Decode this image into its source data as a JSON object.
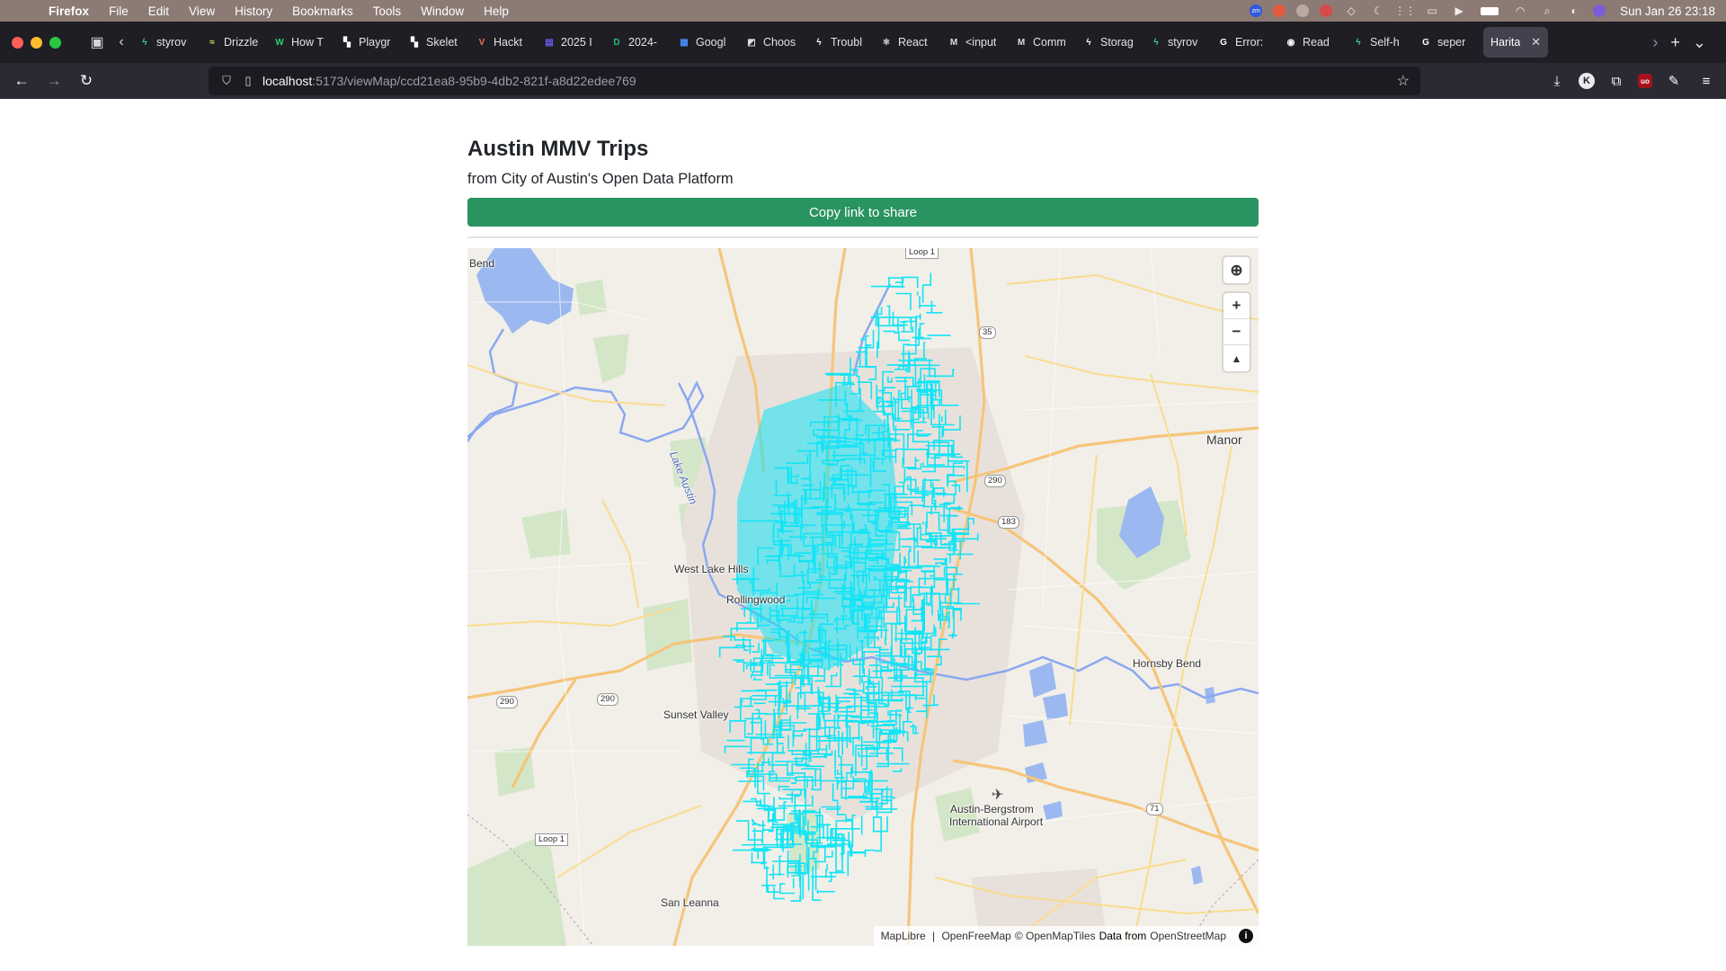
{
  "menubar": {
    "app_name": "Firefox",
    "items": [
      "File",
      "Edit",
      "View",
      "History",
      "Bookmarks",
      "Tools",
      "Window",
      "Help"
    ],
    "status_zm": "zm",
    "clock": "Sun Jan 26  23:18"
  },
  "browser": {
    "tabs": [
      {
        "label": "styrov",
        "icon": "bolt-icon",
        "color": "#3ecf8e"
      },
      {
        "label": "Drizzle",
        "icon": "drizzle-icon",
        "color": "#c5f74f"
      },
      {
        "label": "How T",
        "icon": "w-icon",
        "color": "#29d36e"
      },
      {
        "label": "Playgr",
        "icon": "playground-icon",
        "color": "#ffffff"
      },
      {
        "label": "Skelet",
        "icon": "skeleton-icon",
        "color": "#ffffff"
      },
      {
        "label": "Hackt",
        "icon": "v-icon",
        "color": "#e9784b"
      },
      {
        "label": "2025 I",
        "icon": "calendar-icon",
        "color": "#6a5cf0"
      },
      {
        "label": "2024-",
        "icon": "d-icon",
        "color": "#20c070"
      },
      {
        "label": "Googl",
        "icon": "doc-icon",
        "color": "#4a8cf7"
      },
      {
        "label": "Choos",
        "icon": "choose-icon",
        "color": "#dddddd"
      },
      {
        "label": "Troubl",
        "icon": "bolt-icon",
        "color": "#ffffff"
      },
      {
        "label": "React",
        "icon": "react-icon",
        "color": "#dddddd"
      },
      {
        "label": "<input",
        "icon": "m-icon",
        "color": "#dddddd"
      },
      {
        "label": "Comm",
        "icon": "m-icon",
        "color": "#dddddd"
      },
      {
        "label": "Storag",
        "icon": "bolt-icon",
        "color": "#ffffff"
      },
      {
        "label": "styrov",
        "icon": "bolt-icon",
        "color": "#3ecf8e"
      },
      {
        "label": "Error:",
        "icon": "google-icon",
        "color": "#ffffff"
      },
      {
        "label": "Read",
        "icon": "eye-icon",
        "color": "#ffffff"
      },
      {
        "label": "Self-h",
        "icon": "bolt-icon",
        "color": "#3ecf8e"
      },
      {
        "label": "seper",
        "icon": "google-icon",
        "color": "#ffffff"
      }
    ],
    "active_tab": "Harita",
    "url_host": "localhost",
    "url_path": ":5173/viewMap/ccd21ea8-95b9-4db2-821f-a8d22edee769"
  },
  "page": {
    "title": "Austin MMV Trips",
    "subtitle": "from City of Austin's Open Data Platform",
    "share_button": "Copy link to share"
  },
  "map": {
    "places": {
      "bend": "Bend",
      "manor": "Manor",
      "lake_austin": "Lake Austin",
      "west_lake_hills": "West Lake Hills",
      "rollingwood": "Rollingwood",
      "sunset_valley": "Sunset Valley",
      "hornsby_bend": "Hornsby Bend",
      "airport_line1": "Austin-Bergstrom",
      "airport_line2": "International Airport",
      "san_leanna": "San Leanna"
    },
    "shields": {
      "loop1_top": "Loop 1",
      "loop1_bottom": "Loop 1",
      "i35": "35",
      "us290_east": "290",
      "us183": "183",
      "us290_west_a": "290",
      "us290_west_b": "290",
      "sh71": "71"
    },
    "trip_color": "#12e4f5",
    "attribution": {
      "maplibre": "MapLibre",
      "sep": " | ",
      "openfreemap": "OpenFreeMap",
      "omt": "© OpenMapTiles",
      "data_from": "Data from",
      "osm": "OpenStreetMap"
    }
  }
}
